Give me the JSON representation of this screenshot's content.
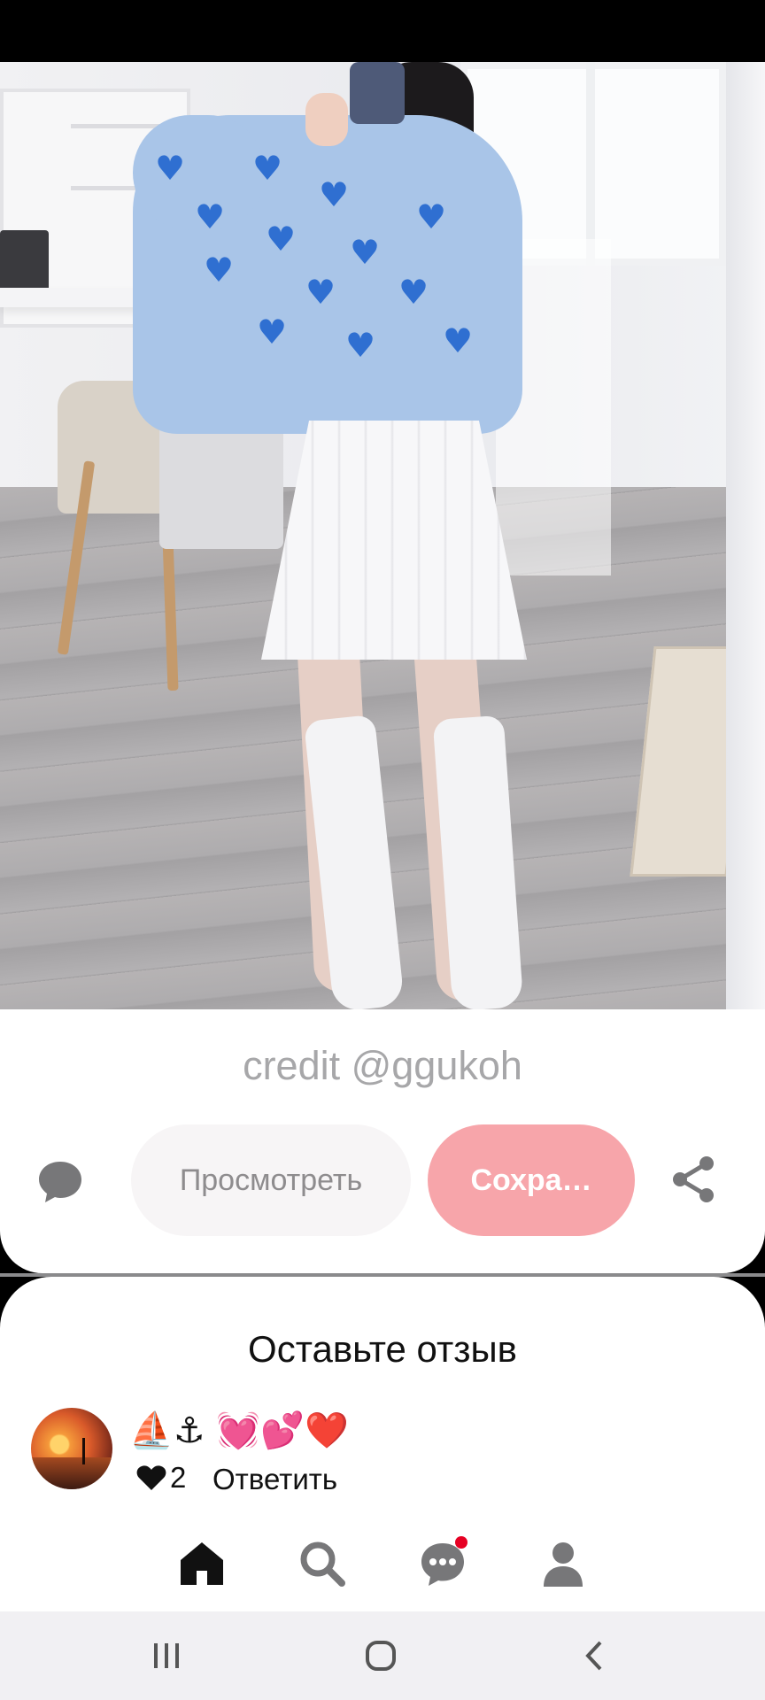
{
  "pin": {
    "credit": "credit @ggukoh",
    "view_button": "Просмотреть",
    "save_button": "Сохра…"
  },
  "comments": {
    "title": "Оставьте отзыв",
    "items": [
      {
        "text": "⛵⚓ 💓💕❤️",
        "likes": "2",
        "reply_label": "Ответить"
      }
    ]
  },
  "colors": {
    "save_accent": "#f7a5aa",
    "notification_dot": "#e60023"
  },
  "icons": {
    "comment": "chat-bubble-icon",
    "share": "share-icon",
    "like": "heart-icon",
    "nav": [
      "home-icon",
      "search-icon",
      "messages-icon",
      "profile-icon"
    ],
    "system": [
      "recent-apps-icon",
      "home-circle-icon",
      "back-icon"
    ]
  }
}
